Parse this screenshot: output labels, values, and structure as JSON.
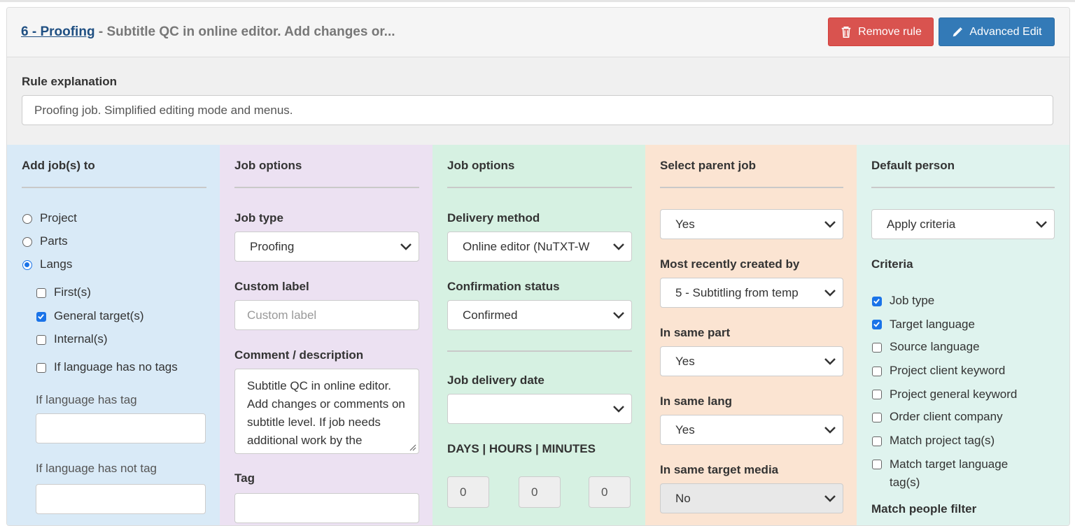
{
  "header": {
    "rule_link": "6 - Proofing",
    "rule_desc": " - Subtitle QC in online editor. Add changes or...",
    "remove_label": "Remove rule",
    "advanced_label": "Advanced Edit"
  },
  "explanation": {
    "label": "Rule explanation",
    "value": "Proofing job. Simplified editing mode and menus."
  },
  "col1": {
    "title": "Add job(s) to",
    "radios": [
      "Project",
      "Parts",
      "Langs"
    ],
    "selected_radio": "Langs",
    "checks": [
      {
        "label": "First(s)",
        "checked": false
      },
      {
        "label": "General target(s)",
        "checked": true
      },
      {
        "label": "Internal(s)",
        "checked": false
      },
      {
        "label": "If language has no tags",
        "checked": false
      }
    ],
    "has_tag_label": "If language has tag",
    "has_not_tag_label": "If language has not tag"
  },
  "col2": {
    "title": "Job options",
    "job_type_label": "Job type",
    "job_type_value": "Proofing",
    "custom_label_label": "Custom label",
    "custom_label_placeholder": "Custom label",
    "comment_label": "Comment / description",
    "comment_value": "Subtitle QC in online editor. Add changes or comments on subtitle level. If job needs additional work by the translator please",
    "tag_label": "Tag"
  },
  "col3": {
    "title": "Job options",
    "delivery_method_label": "Delivery method",
    "delivery_method_value": "Online editor (NuTXT-W",
    "confirmation_label": "Confirmation status",
    "confirmation_value": "Confirmed",
    "delivery_date_label": "Job delivery date",
    "delivery_date_value": "",
    "dhm_label": "DAYS | HOURS | MINUTES",
    "days": "0",
    "hours": "0",
    "minutes": "0"
  },
  "col4": {
    "title": "Select parent job",
    "parent_value": "Yes",
    "recent_label": "Most recently created by",
    "recent_value": "5 - Subtitling from temp",
    "same_part_label": "In same part",
    "same_part_value": "Yes",
    "same_lang_label": "In same lang",
    "same_lang_value": "Yes",
    "same_media_label": "In same target media",
    "same_media_value": "No"
  },
  "col5": {
    "title": "Default person",
    "default_value": "Apply criteria",
    "criteria_label": "Criteria",
    "criteria": [
      {
        "label": "Job type",
        "checked": true
      },
      {
        "label": "Target language",
        "checked": true
      },
      {
        "label": "Source language",
        "checked": false
      },
      {
        "label": "Project client keyword",
        "checked": false
      },
      {
        "label": "Project general keyword",
        "checked": false
      },
      {
        "label": "Order client company",
        "checked": false
      },
      {
        "label": "Match project tag(s)",
        "checked": false
      },
      {
        "label": "Match target language",
        "checked": false
      }
    ],
    "criteria_wrap": "tag(s)",
    "people_filter_label": "Match people filter"
  },
  "colors": {
    "link": "#1f4f82",
    "danger": "#d9534f",
    "primary": "#337ab7",
    "col1_bg": "#d9eaf7",
    "col2_bg": "#ece1f2",
    "col3_bg": "#d6f1e2",
    "col4_bg": "#fbe4d2",
    "col5_bg": "#dff3ee",
    "check_accent": "#1a73e8"
  }
}
